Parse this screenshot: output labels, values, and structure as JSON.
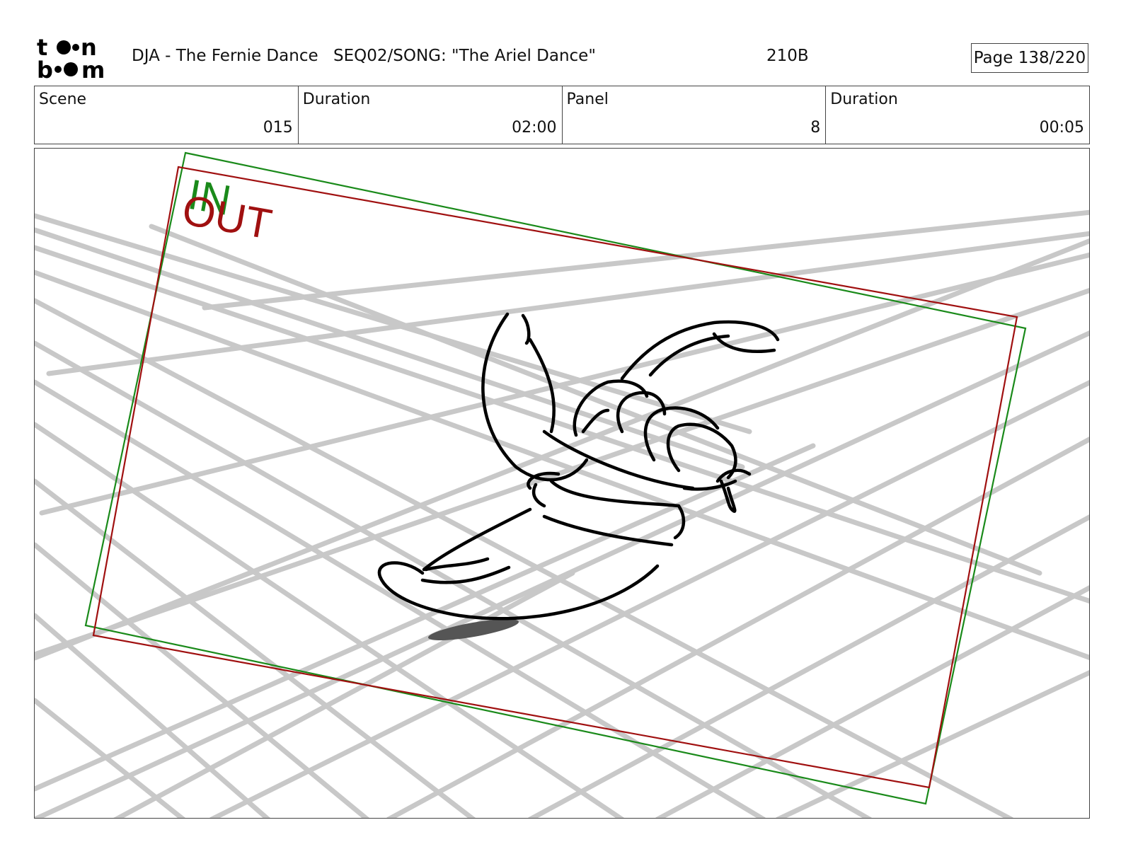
{
  "header": {
    "logo_text": "toonboom",
    "project": "DJA - The Fernie Dance",
    "sequence": "SEQ02/SONG: \"The Ariel Dance\"",
    "code": "210B",
    "page": "Page 138/220"
  },
  "info": [
    {
      "label": "Scene",
      "value": "015"
    },
    {
      "label": "Duration",
      "value": "02:00"
    },
    {
      "label": "Panel",
      "value": "8"
    },
    {
      "label": "Duration",
      "value": "00:05"
    }
  ],
  "panel": {
    "in_label": "IN",
    "out_label": "OUT",
    "colors": {
      "in": "#1a8a1a",
      "out": "#a01010",
      "grid": "#c8c8c8",
      "ink": "#000000"
    }
  }
}
